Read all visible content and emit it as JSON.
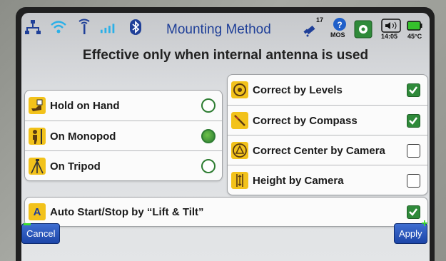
{
  "header": {
    "title": "Mounting Method",
    "satellite_count": "17",
    "mos_label": "MOS",
    "time": "14:05",
    "temperature": "45°C"
  },
  "subtitle": "Effective only when internal antenna is used",
  "mounting_options": [
    {
      "label": "Hold on Hand",
      "selected": false
    },
    {
      "label": "On Monopod",
      "selected": true
    },
    {
      "label": "On Tripod",
      "selected": false
    }
  ],
  "correction_options": [
    {
      "label": "Correct by Levels",
      "checked": true
    },
    {
      "label": "Correct by Compass",
      "checked": true
    },
    {
      "label": "Correct Center by Camera",
      "checked": false
    },
    {
      "label": "Height by Camera",
      "checked": false
    }
  ],
  "auto_option": {
    "icon_letter": "A",
    "label": "Auto Start/Stop by “Lift & Tilt”",
    "checked": true
  },
  "buttons": {
    "cancel": "Cancel",
    "apply": "Apply"
  },
  "colors": {
    "title": "#1f3f98",
    "accent_green": "#2e7d32",
    "button_blue": "#1c45a8"
  }
}
